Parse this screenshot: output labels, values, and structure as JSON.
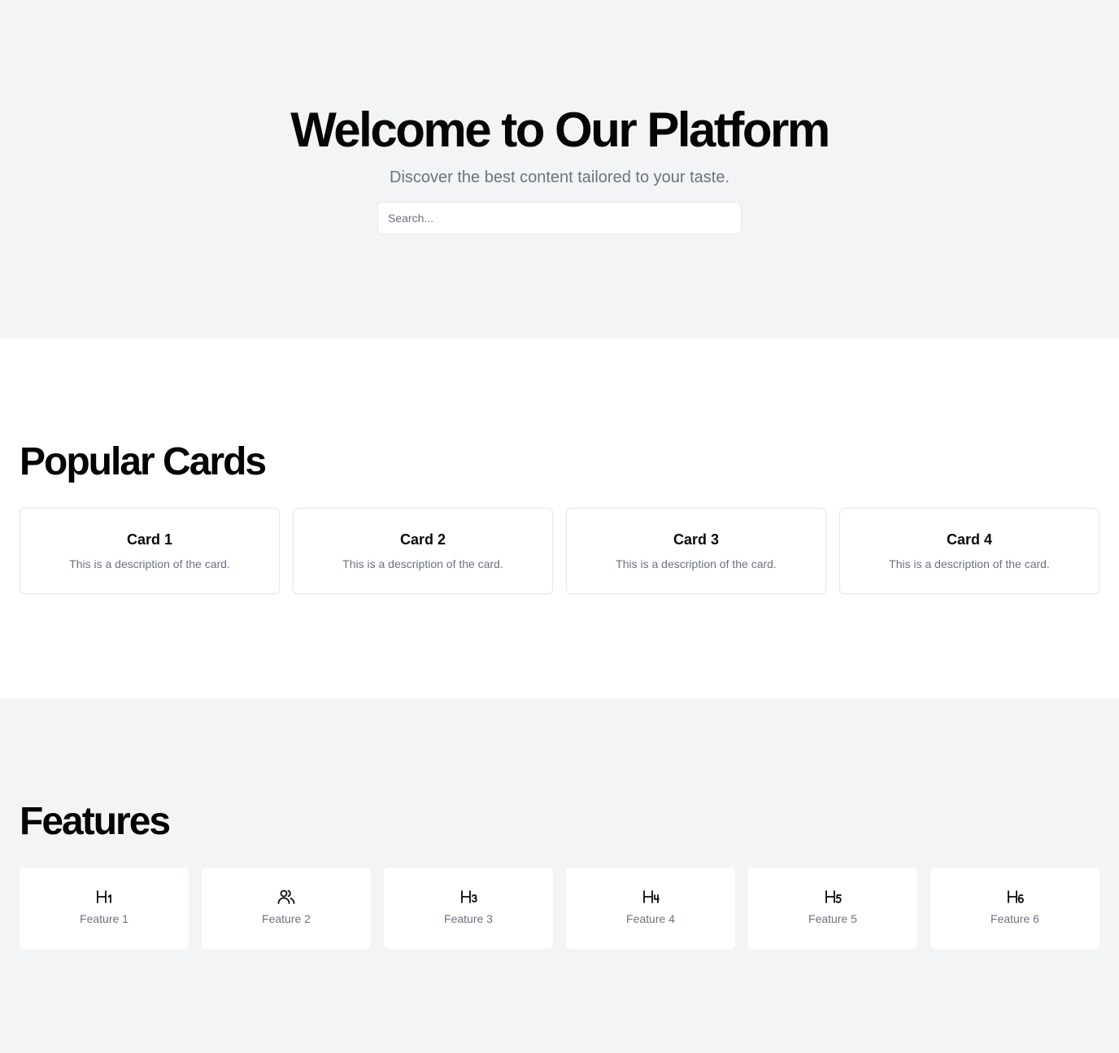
{
  "hero": {
    "title": "Welcome to Our Platform",
    "subtitle": "Discover the best content tailored to your taste.",
    "search": {
      "placeholder": "Search...",
      "value": ""
    }
  },
  "cards_section": {
    "title": "Popular Cards",
    "cards": [
      {
        "title": "Card 1",
        "description": "This is a description of the card."
      },
      {
        "title": "Card 2",
        "description": "This is a description of the card."
      },
      {
        "title": "Card 3",
        "description": "This is a description of the card."
      },
      {
        "title": "Card 4",
        "description": "This is a description of the card."
      }
    ]
  },
  "features_section": {
    "title": "Features",
    "features": [
      {
        "label": "Feature 1",
        "icon": "heading-1-icon"
      },
      {
        "label": "Feature 2",
        "icon": "users-icon"
      },
      {
        "label": "Feature 3",
        "icon": "heading-3-icon"
      },
      {
        "label": "Feature 4",
        "icon": "heading-4-icon"
      },
      {
        "label": "Feature 5",
        "icon": "heading-5-icon"
      },
      {
        "label": "Feature 6",
        "icon": "heading-6-icon"
      }
    ]
  },
  "colors": {
    "hero_bg": "#f3f4f6",
    "section_bg": "#ffffff",
    "muted_text": "#6b7280",
    "border": "#e5e7eb",
    "heading_text": "#050505"
  }
}
